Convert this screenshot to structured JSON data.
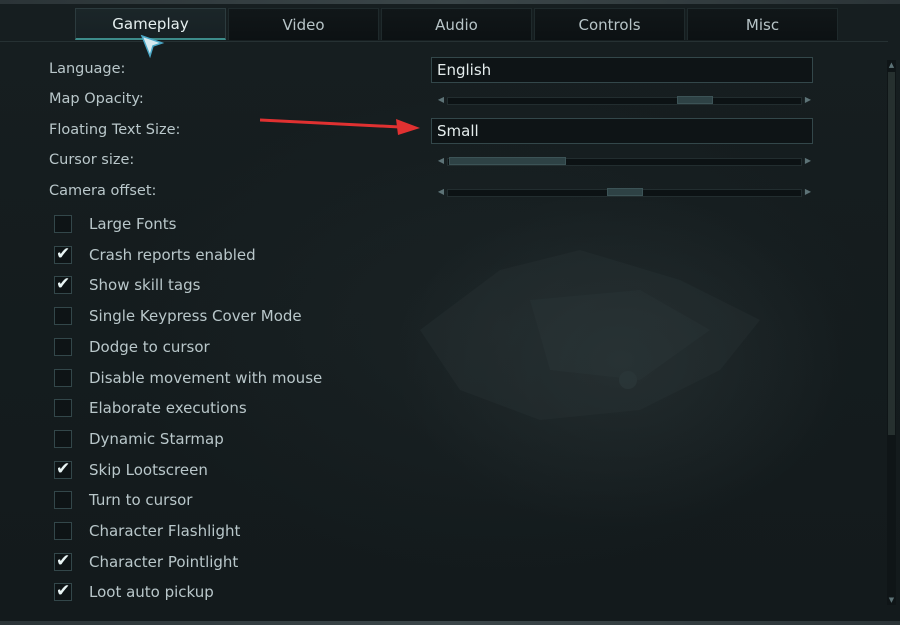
{
  "tabs": [
    {
      "label": "Gameplay",
      "active": true
    },
    {
      "label": "Video",
      "active": false
    },
    {
      "label": "Audio",
      "active": false
    },
    {
      "label": "Controls",
      "active": false
    },
    {
      "label": "Misc",
      "active": false
    }
  ],
  "settings": {
    "language_label": "Language:",
    "language_value": "English",
    "map_opacity_label": "Map Opacity:",
    "map_opacity_level": 0.72,
    "floating_text_label": "Floating Text Size:",
    "floating_text_value": "Small",
    "cursor_size_label": "Cursor size:",
    "cursor_size_level": 0.33,
    "camera_offset_label": "Camera offset:",
    "camera_offset_level": 0.5
  },
  "checkboxes": [
    {
      "label": "Large Fonts",
      "checked": false
    },
    {
      "label": "Crash reports enabled",
      "checked": true
    },
    {
      "label": "Show skill tags",
      "checked": true
    },
    {
      "label": "Single Keypress Cover Mode",
      "checked": false
    },
    {
      "label": "Dodge to cursor",
      "checked": false
    },
    {
      "label": "Disable movement with mouse",
      "checked": false
    },
    {
      "label": "Elaborate executions",
      "checked": false
    },
    {
      "label": "Dynamic Starmap",
      "checked": false
    },
    {
      "label": "Skip Lootscreen",
      "checked": true
    },
    {
      "label": "Turn to cursor",
      "checked": false
    },
    {
      "label": "Character Flashlight",
      "checked": false
    },
    {
      "label": "Character Pointlight",
      "checked": true
    },
    {
      "label": "Loot auto pickup",
      "checked": true
    }
  ],
  "colors": {
    "accent": "#3d8c8a",
    "annotation_arrow": "#e03131",
    "check": "#e8f4f4"
  },
  "icons": {
    "check": "check-icon",
    "cursor": "mouse-cursor-icon",
    "annotation": "red-arrow-icon"
  }
}
